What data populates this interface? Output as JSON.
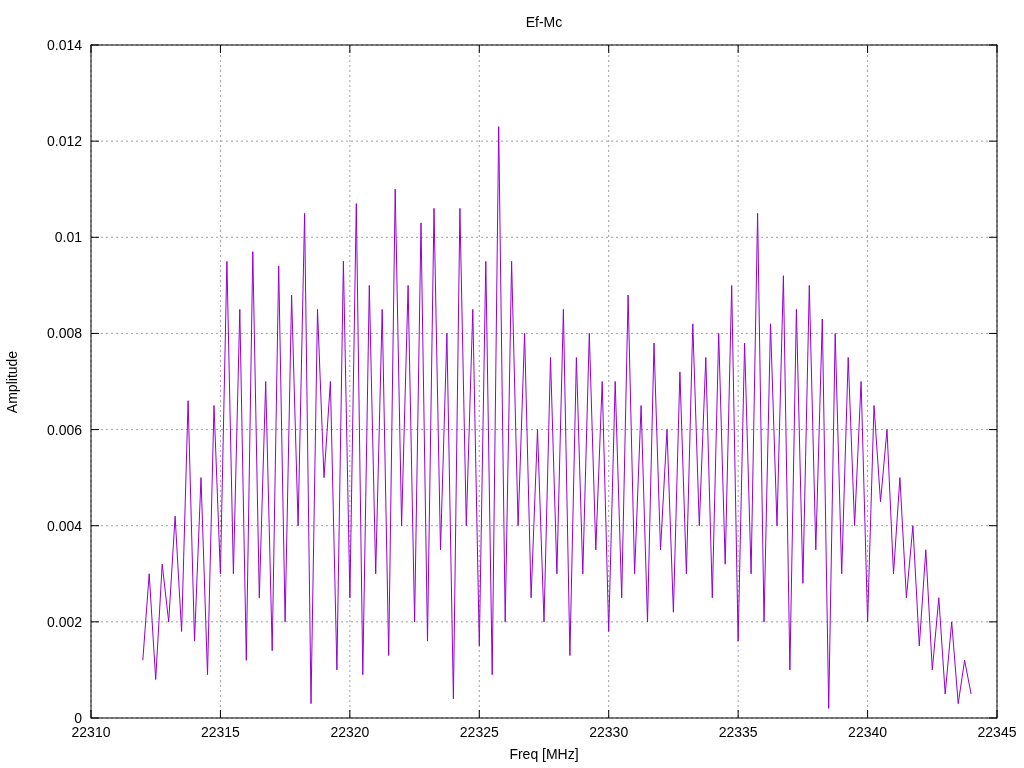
{
  "chart_data": {
    "type": "line",
    "title": "Ef-Mc",
    "xlabel": "Freq [MHz]",
    "ylabel": "Amplitude",
    "grid": true,
    "xlim": [
      22310,
      22345
    ],
    "ylim": [
      0,
      0.014
    ],
    "xticks": [
      22310,
      22315,
      22320,
      22325,
      22330,
      22335,
      22340,
      22345
    ],
    "yticks": [
      {
        "value": 0,
        "label": "0"
      },
      {
        "value": 0.002,
        "label": "0.002"
      },
      {
        "value": 0.004,
        "label": "0.004"
      },
      {
        "value": 0.006,
        "label": "0.006"
      },
      {
        "value": 0.008,
        "label": "0.008"
      },
      {
        "value": 0.01,
        "label": "0.01"
      },
      {
        "value": 0.012,
        "label": "0.012"
      },
      {
        "value": 0.014,
        "label": "0.014"
      }
    ],
    "x": [
      22312,
      22312.25,
      22312.5,
      22312.75,
      22313,
      22313.25,
      22313.5,
      22313.75,
      22314,
      22314.25,
      22314.5,
      22314.75,
      22315,
      22315.25,
      22315.5,
      22315.75,
      22316,
      22316.25,
      22316.5,
      22316.75,
      22317,
      22317.25,
      22317.5,
      22317.75,
      22318,
      22318.25,
      22318.5,
      22318.75,
      22319,
      22319.25,
      22319.5,
      22319.75,
      22320,
      22320.25,
      22320.5,
      22320.75,
      22321,
      22321.25,
      22321.5,
      22321.75,
      22322,
      22322.25,
      22322.5,
      22322.75,
      22323,
      22323.25,
      22323.5,
      22323.75,
      22324,
      22324.25,
      22324.5,
      22324.75,
      22325,
      22325.25,
      22325.5,
      22325.75,
      22326,
      22326.25,
      22326.5,
      22326.75,
      22327,
      22327.25,
      22327.5,
      22327.75,
      22328,
      22328.25,
      22328.5,
      22328.75,
      22329,
      22329.25,
      22329.5,
      22329.75,
      22330,
      22330.25,
      22330.5,
      22330.75,
      22331,
      22331.25,
      22331.5,
      22331.75,
      22332,
      22332.25,
      22332.5,
      22332.75,
      22333,
      22333.25,
      22333.5,
      22333.75,
      22334,
      22334.25,
      22334.5,
      22334.75,
      22335,
      22335.25,
      22335.5,
      22335.75,
      22336,
      22336.25,
      22336.5,
      22336.75,
      22337,
      22337.25,
      22337.5,
      22337.75,
      22338,
      22338.25,
      22338.5,
      22338.75,
      22339,
      22339.25,
      22339.5,
      22339.75,
      22340,
      22340.25,
      22340.5,
      22340.75,
      22341,
      22341.25,
      22341.5,
      22341.75,
      22342,
      22342.25,
      22342.5,
      22342.75,
      22343,
      22343.25,
      22343.5,
      22343.75,
      22344
    ],
    "series": [
      {
        "color": "#9400d3",
        "values": [
          0.0012,
          0.003,
          0.0008,
          0.0032,
          0.002,
          0.0042,
          0.0018,
          0.0066,
          0.0016,
          0.005,
          0.0009,
          0.0065,
          0.003,
          0.0095,
          0.003,
          0.0085,
          0.0012,
          0.0097,
          0.0025,
          0.007,
          0.0014,
          0.0094,
          0.002,
          0.0088,
          0.004,
          0.0105,
          0.0003,
          0.0085,
          0.005,
          0.007,
          0.001,
          0.0095,
          0.0025,
          0.0107,
          0.0009,
          0.009,
          0.003,
          0.0085,
          0.0013,
          0.011,
          0.004,
          0.009,
          0.002,
          0.0103,
          0.0016,
          0.0106,
          0.0035,
          0.008,
          0.0004,
          0.0106,
          0.004,
          0.0085,
          0.0015,
          0.0095,
          0.0009,
          0.0123,
          0.002,
          0.0095,
          0.004,
          0.008,
          0.0025,
          0.006,
          0.002,
          0.0075,
          0.003,
          0.0085,
          0.0013,
          0.0075,
          0.003,
          0.008,
          0.0035,
          0.007,
          0.0018,
          0.007,
          0.0025,
          0.0088,
          0.003,
          0.0065,
          0.002,
          0.0078,
          0.0035,
          0.006,
          0.0022,
          0.0072,
          0.003,
          0.0082,
          0.004,
          0.0075,
          0.0025,
          0.008,
          0.0032,
          0.009,
          0.0016,
          0.0078,
          0.003,
          0.0105,
          0.002,
          0.0082,
          0.004,
          0.0092,
          0.001,
          0.0085,
          0.0028,
          0.009,
          0.0035,
          0.0083,
          0.0002,
          0.008,
          0.003,
          0.0075,
          0.004,
          0.007,
          0.002,
          0.0065,
          0.0045,
          0.006,
          0.003,
          0.005,
          0.0025,
          0.004,
          0.0015,
          0.0035,
          0.001,
          0.0025,
          0.0005,
          0.002,
          0.0003,
          0.0012,
          0.0005
        ]
      }
    ]
  }
}
